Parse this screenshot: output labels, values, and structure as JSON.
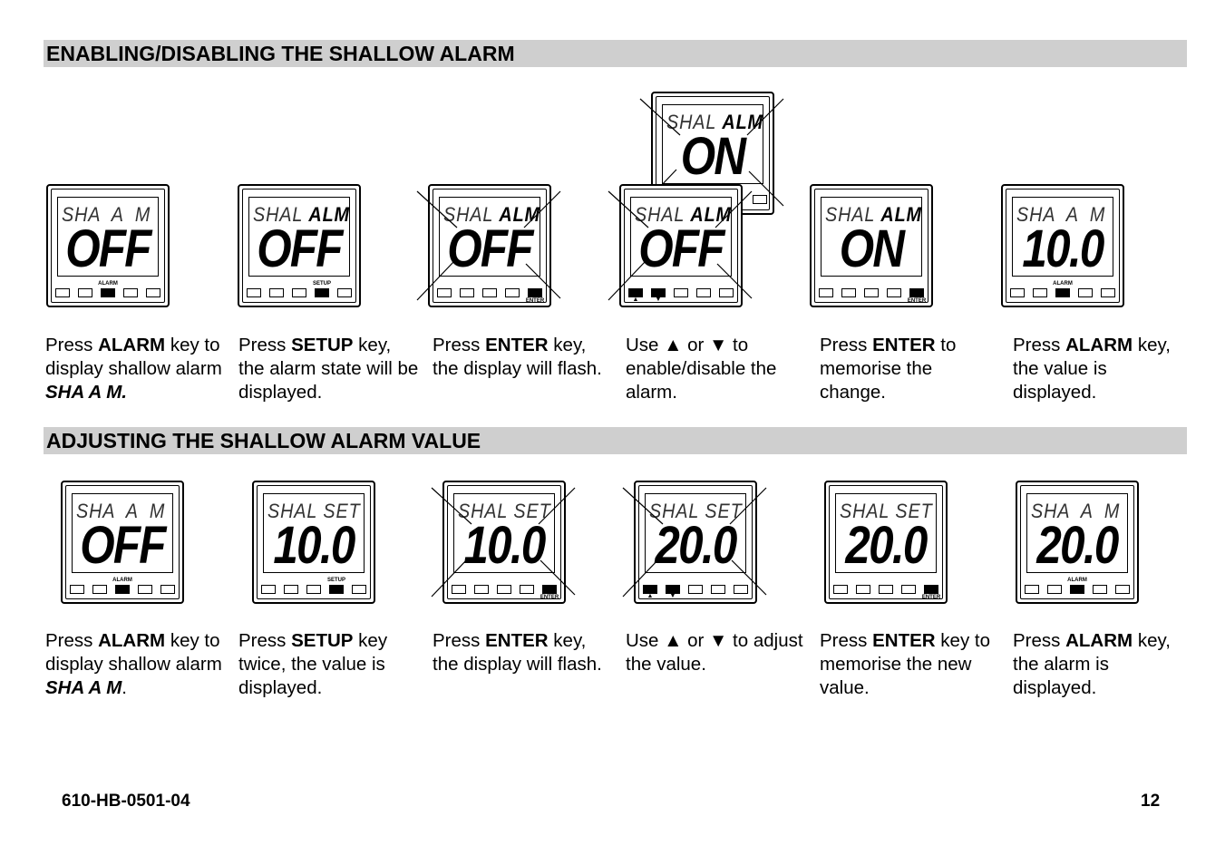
{
  "sections": [
    {
      "title": "ENABLING/DISABLING THE SHALLOW ALARM"
    },
    {
      "title": "ADJUSTING THE SHALLOW ALARM VALUE"
    }
  ],
  "displays": [
    {
      "light": "SHA  A  M",
      "bold": "",
      "value": "OFF",
      "active": [
        3
      ],
      "label": "ALARM",
      "flash": false
    },
    {
      "light": "SHAL ",
      "bold": "ALM",
      "value": "OFF",
      "active": [
        4
      ],
      "label": "SETUP",
      "flash": false
    },
    {
      "light": "SHAL ",
      "bold": "ALM",
      "value": "OFF",
      "active": [
        5
      ],
      "label": "ENTER",
      "flash": true
    },
    {
      "light": "SHAL ",
      "bold": "ALM",
      "value": "ON",
      "active": [],
      "label": "",
      "flash": true,
      "back": true
    },
    {
      "light": "SHAL ",
      "bold": "ALM",
      "value": "OFF",
      "active": [
        1,
        2
      ],
      "label": "",
      "arrows": [
        "▲",
        "▼"
      ],
      "flash": true
    },
    {
      "light": "SHAL ",
      "bold": "ALM",
      "value": "ON",
      "active": [
        5
      ],
      "label": "ENTER",
      "flash": false
    },
    {
      "light": "SHA  A  M",
      "bold": "",
      "value": "10.0",
      "active": [
        3
      ],
      "label": "ALARM",
      "flash": false
    },
    {
      "light": "SHA  A  M",
      "bold": "",
      "value": "OFF",
      "active": [
        3
      ],
      "label": "ALARM",
      "flash": false
    },
    {
      "light": "SHAL SET",
      "bold": "",
      "value": "10.0",
      "active": [
        4
      ],
      "label": "SETUP",
      "flash": false
    },
    {
      "light": "SHAL SET",
      "bold": "",
      "value": "10.0",
      "active": [
        5
      ],
      "label": "ENTER",
      "flash": true
    },
    {
      "light": "SHAL SET",
      "bold": "",
      "value": "20.0",
      "active": [
        1,
        2
      ],
      "label": "",
      "arrows": [
        "▲",
        "▼"
      ],
      "flash": true
    },
    {
      "light": "SHAL SET",
      "bold": "",
      "value": "20.0",
      "active": [
        5
      ],
      "label": "ENTER",
      "flash": false
    },
    {
      "light": "SHA  A  M",
      "bold": "",
      "value": "20.0",
      "active": [
        3
      ],
      "label": "ALARM",
      "flash": false
    }
  ],
  "captions": [
    [
      [
        "Press ",
        ""
      ],
      [
        "ALARM",
        "b"
      ],
      [
        " key to display shallow alarm ",
        ""
      ],
      [
        "SHA A M.",
        "bi"
      ]
    ],
    [
      [
        "Press ",
        ""
      ],
      [
        "SETUP",
        "b"
      ],
      [
        " key, the alarm state will be displayed.",
        ""
      ]
    ],
    [
      [
        "Press ",
        ""
      ],
      [
        "ENTER",
        "b"
      ],
      [
        " key, the display will flash.",
        ""
      ]
    ],
    [
      [
        "Use ▲ or ▼ to enable/disable the alarm.",
        ""
      ]
    ],
    [
      [
        "Press ",
        ""
      ],
      [
        "ENTER",
        "b"
      ],
      [
        " to memorise the change.",
        ""
      ]
    ],
    [
      [
        "Press ",
        ""
      ],
      [
        "ALARM",
        "b"
      ],
      [
        " key, the value is displayed.",
        ""
      ]
    ],
    [
      [
        "Press ",
        ""
      ],
      [
        "ALARM",
        "b"
      ],
      [
        " key to display shallow alarm ",
        ""
      ],
      [
        "SHA A M",
        "bi"
      ],
      [
        ".",
        ""
      ]
    ],
    [
      [
        "Press ",
        ""
      ],
      [
        "SETUP",
        "b"
      ],
      [
        " key twice, the value is displayed.",
        ""
      ]
    ],
    [
      [
        "Press ",
        ""
      ],
      [
        "ENTER",
        "b"
      ],
      [
        " key, the display will flash.",
        ""
      ]
    ],
    [
      [
        "Use ▲ or ▼ to adjust the value.",
        ""
      ]
    ],
    [
      [
        "Press ",
        ""
      ],
      [
        "ENTER",
        "b"
      ],
      [
        " key to memorise the new value.",
        ""
      ]
    ],
    [
      [
        "Press ",
        ""
      ],
      [
        "ALARM",
        "b"
      ],
      [
        " key, the alarm is displayed.",
        ""
      ]
    ]
  ],
  "footer": {
    "doc_code": "610-HB-0501-04",
    "page_number": "12"
  }
}
